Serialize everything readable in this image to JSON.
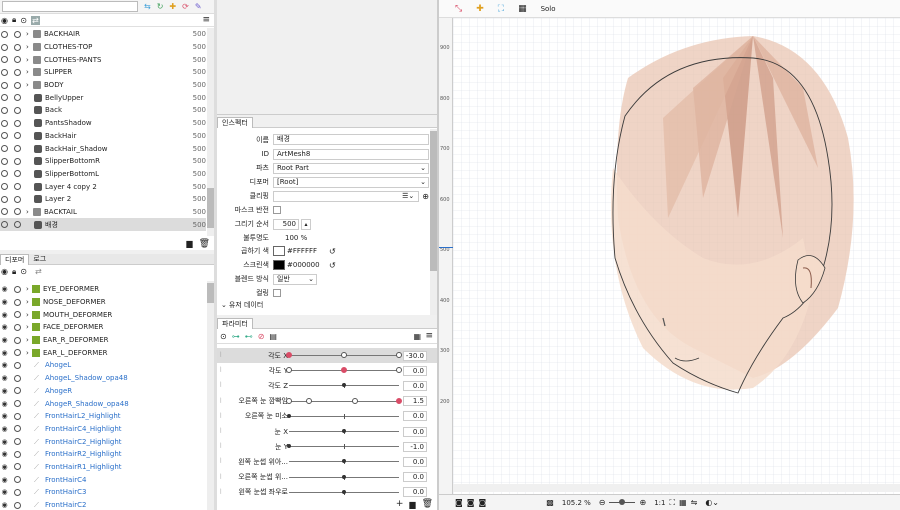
{
  "parts": {
    "items": [
      {
        "name": "BACKHAIR",
        "type": "folder",
        "value": "500"
      },
      {
        "name": "CLOTHES-TOP",
        "type": "folder",
        "value": "500"
      },
      {
        "name": "CLOTHES-PANTS",
        "type": "folder",
        "value": "500"
      },
      {
        "name": "SLIPPER",
        "type": "folder",
        "value": "500"
      },
      {
        "name": "BODY",
        "type": "folder",
        "value": "500"
      },
      {
        "name": "BellyUpper",
        "type": "mesh",
        "value": "500"
      },
      {
        "name": "Back",
        "type": "mesh",
        "value": "500"
      },
      {
        "name": "PantsShadow",
        "type": "mesh",
        "value": "500"
      },
      {
        "name": "BackHair",
        "type": "mesh",
        "value": "500"
      },
      {
        "name": "BackHair_Shadow",
        "type": "mesh",
        "value": "500"
      },
      {
        "name": "SlipperBottomR",
        "type": "mesh",
        "value": "500"
      },
      {
        "name": "SlipperBottomL",
        "type": "mesh",
        "value": "500"
      },
      {
        "name": "Layer 4 copy 2",
        "type": "mesh",
        "value": "500"
      },
      {
        "name": "Layer 2",
        "type": "mesh",
        "value": "500"
      },
      {
        "name": "BACKTAIL",
        "type": "folder",
        "value": "500"
      },
      {
        "name": "배경",
        "type": "mesh",
        "value": "500"
      }
    ]
  },
  "deformer_panel": {
    "tab_deformer": "디포머",
    "tab_log": "로그",
    "items": [
      {
        "name": "EYE_DEFORMER",
        "kind": "deformer"
      },
      {
        "name": "NOSE_DEFORMER",
        "kind": "deformer"
      },
      {
        "name": "MOUTH_DEFORMER",
        "kind": "deformer"
      },
      {
        "name": "FACE_DEFORMER",
        "kind": "deformer"
      },
      {
        "name": "EAR_R_DEFORMER",
        "kind": "deformer"
      },
      {
        "name": "EAR_L_DEFORMER",
        "kind": "deformer"
      },
      {
        "name": "AhogeL",
        "kind": "art"
      },
      {
        "name": "AhogeL_Shadow_opa48",
        "kind": "art"
      },
      {
        "name": "AhogeR",
        "kind": "art"
      },
      {
        "name": "AhogeR_Shadow_opa48",
        "kind": "art"
      },
      {
        "name": "FrontHairL2_Highlight",
        "kind": "art"
      },
      {
        "name": "FrontHairC4_Highlight",
        "kind": "art"
      },
      {
        "name": "FrontHairC2_Highlight",
        "kind": "art"
      },
      {
        "name": "FrontHairR2_Highlight",
        "kind": "art"
      },
      {
        "name": "FrontHairR1_Highlight",
        "kind": "art"
      },
      {
        "name": "FrontHairC4",
        "kind": "art"
      },
      {
        "name": "FrontHairC3",
        "kind": "art"
      },
      {
        "name": "FrontHairC2",
        "kind": "art"
      }
    ]
  },
  "inspector": {
    "tab": "인스펙터",
    "name_label": "이름",
    "name_value": "배경",
    "id_label": "ID",
    "id_value": "ArtMesh8",
    "parts_label": "파츠",
    "parts_value": "Root Part",
    "deformer_label": "디포머",
    "deformer_value": "[Root]",
    "clipping_label": "클리핑",
    "mask_invert_label": "마스크 반전",
    "draw_order_label": "그리기 순서",
    "draw_order_value": "500",
    "opacity_label": "불투명도",
    "opacity_value": "100 %",
    "multiply_label": "곱하기 색",
    "multiply_value": "#FFFFFF",
    "screen_label": "스크린색",
    "screen_value": "#000000",
    "blend_label": "블렌드 방식",
    "blend_value": "일반",
    "culling_label": "컬링",
    "user_data_label": "유저 데이터"
  },
  "parameters": {
    "tab": "파라미터",
    "items": [
      {
        "label": "각도 X",
        "value": "-30.0",
        "level": 0.0,
        "knobs": [
          0,
          0.5,
          1
        ],
        "selected": true
      },
      {
        "label": "각도 Y",
        "value": "0.0",
        "level": 0.5,
        "knobs": [
          0,
          0.5,
          1
        ],
        "selected": false
      },
      {
        "label": "각도 Z",
        "value": "0.0",
        "level": 0.5,
        "knobs": [],
        "selected": false
      },
      {
        "label": "오른쪽 눈 깜빡임",
        "value": "1.5",
        "level": 1.0,
        "knobs": [
          0,
          0.18,
          0.6,
          1
        ],
        "selected": false
      },
      {
        "label": "오른쪽 눈 미소",
        "value": "0.0",
        "level": 0.0,
        "knobs": [],
        "selected": false
      },
      {
        "label": "눈 X",
        "value": "0.0",
        "level": 0.5,
        "knobs": [],
        "selected": false
      },
      {
        "label": "눈 Y",
        "value": "-1.0",
        "level": 0.0,
        "knobs": [],
        "selected": false
      },
      {
        "label": "왼쪽 눈썹 위아...",
        "value": "0.0",
        "level": 0.5,
        "knobs": [],
        "selected": false
      },
      {
        "label": "오른쪽 눈썹 위...",
        "value": "0.0",
        "level": 0.5,
        "knobs": [],
        "selected": false
      },
      {
        "label": "왼쪽 눈썹 좌우로",
        "value": "0.0",
        "level": 0.5,
        "knobs": [],
        "selected": false
      }
    ]
  },
  "canvas": {
    "solo_label": "Solo",
    "ruler_marks": [
      "900",
      "800",
      "700",
      "600",
      "500",
      "400",
      "300",
      "200"
    ],
    "zoom_value": "105.2 %",
    "ratio_label": "1:1"
  },
  "colors": {
    "accent": "#d94c67",
    "selection": "#dcdcdc",
    "link_blue": "#2a6fc9",
    "deformer_green": "#7aa82a"
  }
}
